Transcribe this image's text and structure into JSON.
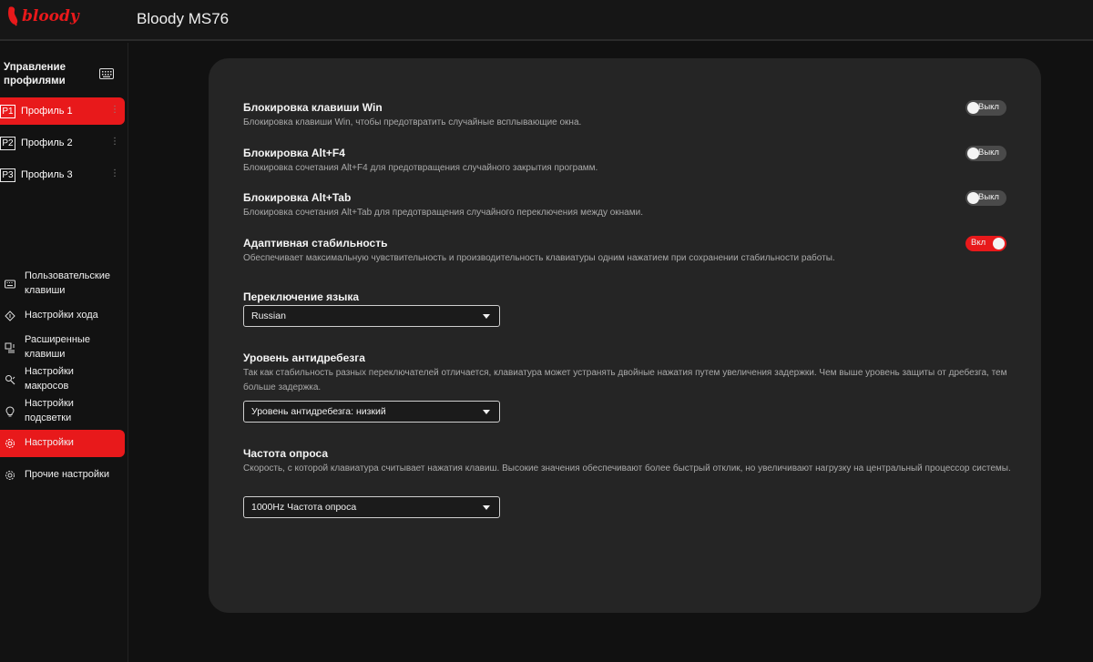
{
  "app": {
    "logo_text": "bloody",
    "title": "Bloody MS76"
  },
  "colors": {
    "accent": "#e8191b",
    "card": "#252525",
    "background": "#111111"
  },
  "sidebar": {
    "profiles_header": "Управление профилями",
    "profiles_icon": "keyboard-icon",
    "profiles": [
      {
        "badge": "P1",
        "label": "Профиль 1",
        "active": true
      },
      {
        "badge": "P2",
        "label": "Профиль 2",
        "active": false
      },
      {
        "badge": "P3",
        "label": "Профиль 3",
        "active": false
      }
    ],
    "nav": [
      {
        "label": "Пользовательские клавиши",
        "icon": "keyboard-icon"
      },
      {
        "label": "Настройки хода",
        "icon": "diamond-icon"
      },
      {
        "label": "Расширенные клавиши",
        "icon": "advanced-keys-icon"
      },
      {
        "label": "Настройки макросов",
        "icon": "macro-icon"
      },
      {
        "label": "Настройки подсветки",
        "icon": "bulb-icon"
      },
      {
        "label": "Настройки",
        "icon": "gear-icon",
        "active": true
      },
      {
        "label": "Прочие настройки",
        "icon": "gear-icon"
      }
    ]
  },
  "settings": {
    "toggles": [
      {
        "title": "Блокировка клавиши Win",
        "desc": "Блокировка клавиши Win, чтобы предотвратить случайные всплывающие окна.",
        "state": "Выкл",
        "on": false
      },
      {
        "title": "Блокировка Alt+F4",
        "desc": "Блокировка сочетания Alt+F4 для предотвращения случайного закрытия программ.",
        "state": "Выкл",
        "on": false
      },
      {
        "title": "Блокировка Alt+Tab",
        "desc": "Блокировка сочетания Alt+Tab для предотвращения случайного переключения между окнами.",
        "state": "Выкл",
        "on": false
      },
      {
        "title": "Адаптивная стабильность",
        "desc": "Обеспечивает максимальную чувствительность и производительность клавиатуры одним нажатием при сохранении стабильности работы.",
        "state": "Вкл",
        "on": true
      }
    ],
    "language": {
      "title": "Переключение языка",
      "value": "Russian"
    },
    "debounce": {
      "title": "Уровень антидребезга",
      "desc": "Так как стабильность разных переключателей отличается, клавиатура может устранять двойные нажатия путем увеличения задержки. Чем выше уровень защиты от дребезга, тем больше задержка.",
      "value": "Уровень антидребезга: низкий"
    },
    "polling": {
      "title": "Частота опроса",
      "desc": "Скорость, с которой клавиатура считывает нажатия клавиш. Высокие значения обеспечивают более быстрый отклик, но увеличивают нагрузку на центральный процессор системы.",
      "value": "1000Hz Частота опроса"
    }
  }
}
